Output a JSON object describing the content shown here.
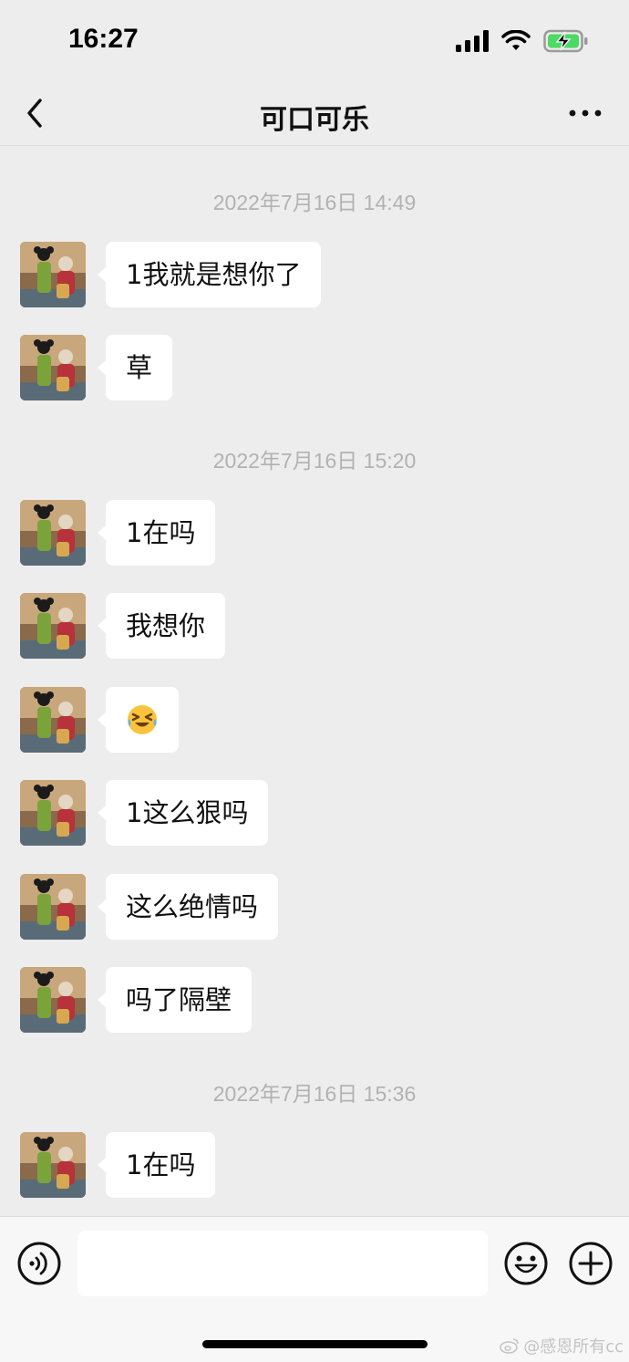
{
  "status_bar": {
    "time": "16:27"
  },
  "nav": {
    "title": "可口可乐"
  },
  "chat": {
    "timestamps": [
      "2022年7月16日 14:49",
      "2022年7月16日 15:20",
      "2022年7月16日 15:36"
    ],
    "messages": [
      {
        "text": "1我就是想你了"
      },
      {
        "text": "草"
      },
      {
        "text": "1在吗"
      },
      {
        "text": "我想你"
      },
      {
        "text": "",
        "emoji": "grinning-squint-tears-emoji"
      },
      {
        "text": "1这么狠吗"
      },
      {
        "text": "这么绝情吗"
      },
      {
        "text": "吗了隔壁"
      },
      {
        "text": "1在吗"
      }
    ]
  },
  "input_bar": {
    "value": "",
    "placeholder": ""
  },
  "watermark": {
    "text": "@感恩所有cc"
  },
  "colors": {
    "background": "#ededed",
    "bubble": "#ffffff",
    "timestamp": "#b2b2b2",
    "battery": "#4cd964"
  }
}
